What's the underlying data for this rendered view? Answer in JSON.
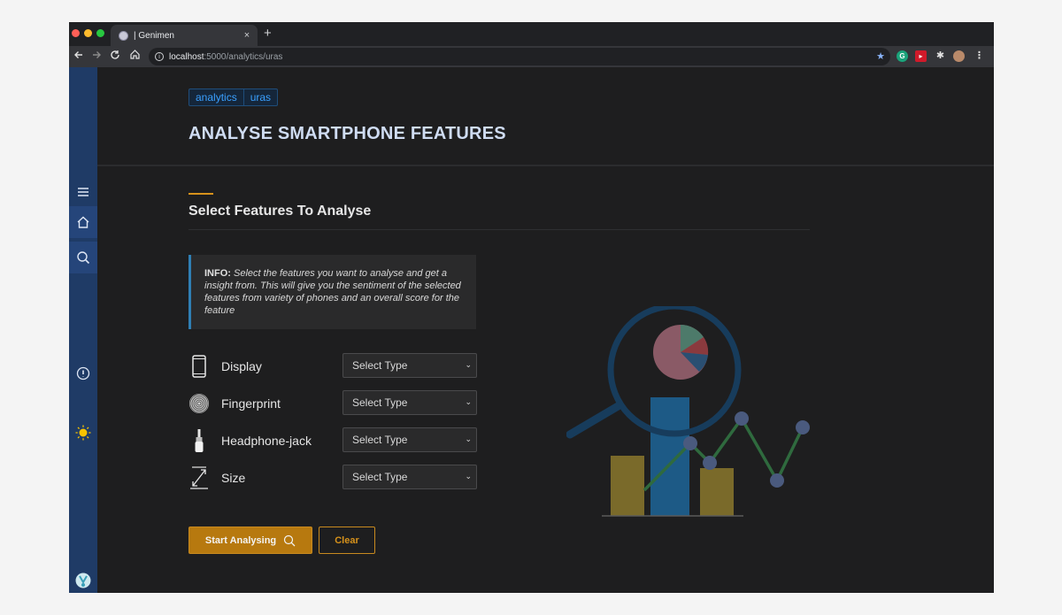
{
  "browser": {
    "tab_title": "| Genimen",
    "tab_close": "×",
    "new_tab": "+",
    "url_host": "localhost",
    "url_path": ":5000/analytics/uras"
  },
  "sidebar": {
    "items": [
      {
        "icon": "menu-icon"
      },
      {
        "icon": "home-icon"
      },
      {
        "icon": "search-icon"
      },
      {
        "icon": "info-icon"
      },
      {
        "icon": "sun-icon"
      },
      {
        "icon": "avatar-icon"
      }
    ]
  },
  "breadcrumb": [
    "analytics",
    "uras"
  ],
  "page_title": "ANALYSE SMARTPHONE FEATURES",
  "section_title": "Select Features To Analyse",
  "info": {
    "label": "INFO:",
    "text": "Select the features you want to analyse and get a insight from. This will give you the sentiment of the selected features from variety of phones and an overall score for the feature"
  },
  "features": [
    {
      "label": "Display",
      "icon": "smartphone-icon",
      "select_value": "Select Type"
    },
    {
      "label": "Fingerprint",
      "icon": "fingerprint-icon",
      "select_value": "Select Type"
    },
    {
      "label": "Headphone-jack",
      "icon": "headphone-jack-icon",
      "select_value": "Select Type"
    },
    {
      "label": "Size",
      "icon": "resize-icon",
      "select_value": "Select Type"
    }
  ],
  "buttons": {
    "start": "Start Analysing",
    "clear": "Clear"
  },
  "colors": {
    "accent": "#d7921b",
    "sidebar": "#1f3b66",
    "link": "#3aa0ff",
    "title": "#cfdcf2"
  }
}
